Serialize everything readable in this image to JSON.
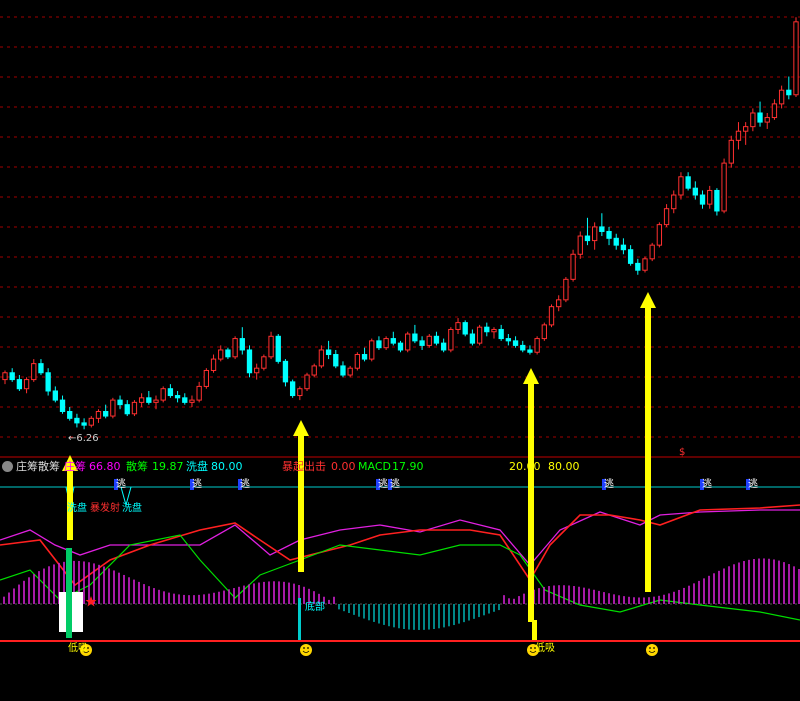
{
  "indicator": {
    "name": "庄筹散筹",
    "values": [
      {
        "label": "庄筹",
        "value": "66.80",
        "color": "#ff00ff"
      },
      {
        "label": "散筹",
        "value": "19.87",
        "color": "#00ff00"
      },
      {
        "label": "洗盘",
        "value": "80.00",
        "color": "#00ffff"
      },
      {
        "label": "暴起出击",
        "value": "0.00",
        "color": "#ff3030"
      },
      {
        "label": "MACD",
        "value": "17.90",
        "color": "#00ff00"
      },
      {
        "label": "",
        "value": "20.00",
        "color": "#ffff00"
      },
      {
        "label": "",
        "value": "80.00",
        "color": "#ffff00"
      }
    ]
  },
  "chart_data": {
    "type": "candlestick",
    "low_marker": "6.26",
    "candles": [
      [
        7.35,
        7.55,
        7.25,
        7.5
      ],
      [
        7.5,
        7.6,
        7.3,
        7.35
      ],
      [
        7.35,
        7.45,
        7.1,
        7.15
      ],
      [
        7.15,
        7.4,
        7.05,
        7.35
      ],
      [
        7.35,
        7.8,
        7.3,
        7.7
      ],
      [
        7.7,
        7.8,
        7.45,
        7.5
      ],
      [
        7.5,
        7.6,
        7.0,
        7.1
      ],
      [
        7.1,
        7.2,
        6.85,
        6.9
      ],
      [
        6.9,
        7.0,
        6.6,
        6.65
      ],
      [
        6.65,
        6.75,
        6.45,
        6.5
      ],
      [
        6.5,
        6.6,
        6.3,
        6.4
      ],
      [
        6.4,
        6.5,
        6.26,
        6.35
      ],
      [
        6.35,
        6.55,
        6.3,
        6.5
      ],
      [
        6.5,
        6.7,
        6.4,
        6.65
      ],
      [
        6.65,
        6.8,
        6.5,
        6.55
      ],
      [
        6.55,
        6.95,
        6.5,
        6.9
      ],
      [
        6.9,
        7.0,
        6.7,
        6.8
      ],
      [
        6.8,
        6.9,
        6.55,
        6.6
      ],
      [
        6.6,
        6.9,
        6.55,
        6.85
      ],
      [
        6.85,
        7.05,
        6.75,
        6.95
      ],
      [
        6.95,
        7.1,
        6.8,
        6.85
      ],
      [
        6.85,
        7.0,
        6.7,
        6.9
      ],
      [
        6.9,
        7.2,
        6.85,
        7.15
      ],
      [
        7.15,
        7.25,
        6.95,
        7.0
      ],
      [
        7.0,
        7.1,
        6.85,
        6.95
      ],
      [
        6.95,
        7.05,
        6.8,
        6.85
      ],
      [
        6.85,
        7.0,
        6.75,
        6.9
      ],
      [
        6.9,
        7.3,
        6.85,
        7.2
      ],
      [
        7.2,
        7.6,
        7.15,
        7.55
      ],
      [
        7.55,
        7.9,
        7.5,
        7.8
      ],
      [
        7.8,
        8.1,
        7.75,
        8.0
      ],
      [
        8.0,
        8.05,
        7.8,
        7.85
      ],
      [
        7.85,
        8.3,
        7.8,
        8.25
      ],
      [
        8.25,
        8.5,
        7.9,
        8.0
      ],
      [
        8.0,
        8.1,
        7.4,
        7.5
      ],
      [
        7.5,
        7.7,
        7.35,
        7.6
      ],
      [
        7.6,
        7.9,
        7.55,
        7.85
      ],
      [
        7.85,
        8.4,
        7.8,
        8.3
      ],
      [
        8.3,
        8.35,
        7.7,
        7.75
      ],
      [
        7.75,
        7.8,
        7.2,
        7.3
      ],
      [
        7.3,
        7.35,
        6.95,
        7.0
      ],
      [
        7.0,
        7.2,
        6.9,
        7.15
      ],
      [
        7.15,
        7.5,
        7.1,
        7.45
      ],
      [
        7.45,
        7.7,
        7.4,
        7.65
      ],
      [
        7.65,
        8.1,
        7.6,
        8.0
      ],
      [
        8.0,
        8.2,
        7.8,
        7.9
      ],
      [
        7.9,
        8.0,
        7.6,
        7.65
      ],
      [
        7.65,
        7.75,
        7.4,
        7.45
      ],
      [
        7.45,
        7.65,
        7.4,
        7.6
      ],
      [
        7.6,
        7.95,
        7.55,
        7.9
      ],
      [
        7.9,
        8.05,
        7.75,
        7.8
      ],
      [
        7.8,
        8.25,
        7.75,
        8.2
      ],
      [
        8.2,
        8.3,
        8.0,
        8.05
      ],
      [
        8.05,
        8.3,
        8.0,
        8.25
      ],
      [
        8.25,
        8.4,
        8.1,
        8.15
      ],
      [
        8.15,
        8.2,
        7.95,
        8.0
      ],
      [
        8.0,
        8.4,
        7.95,
        8.35
      ],
      [
        8.35,
        8.55,
        8.15,
        8.2
      ],
      [
        8.2,
        8.3,
        8.0,
        8.1
      ],
      [
        8.1,
        8.35,
        8.05,
        8.3
      ],
      [
        8.3,
        8.4,
        8.1,
        8.15
      ],
      [
        8.15,
        8.25,
        7.95,
        8.0
      ],
      [
        8.0,
        8.5,
        7.95,
        8.45
      ],
      [
        8.45,
        8.7,
        8.35,
        8.6
      ],
      [
        8.6,
        8.65,
        8.3,
        8.35
      ],
      [
        8.35,
        8.45,
        8.1,
        8.15
      ],
      [
        8.15,
        8.55,
        8.1,
        8.5
      ],
      [
        8.5,
        8.6,
        8.3,
        8.4
      ],
      [
        8.4,
        8.5,
        8.25,
        8.45
      ],
      [
        8.45,
        8.55,
        8.2,
        8.25
      ],
      [
        8.25,
        8.35,
        8.1,
        8.2
      ],
      [
        8.2,
        8.3,
        8.05,
        8.1
      ],
      [
        8.1,
        8.2,
        7.95,
        8.0
      ],
      [
        8.0,
        8.1,
        7.9,
        7.95
      ],
      [
        7.95,
        8.3,
        7.9,
        8.25
      ],
      [
        8.25,
        8.6,
        8.2,
        8.55
      ],
      [
        8.55,
        9.0,
        8.5,
        8.95
      ],
      [
        8.95,
        9.2,
        8.85,
        9.1
      ],
      [
        9.1,
        9.6,
        9.05,
        9.55
      ],
      [
        9.55,
        10.2,
        9.5,
        10.1
      ],
      [
        10.1,
        10.6,
        10.0,
        10.5
      ],
      [
        10.5,
        10.9,
        10.3,
        10.4
      ],
      [
        10.4,
        10.8,
        10.2,
        10.7
      ],
      [
        10.7,
        11.0,
        10.5,
        10.6
      ],
      [
        10.6,
        10.7,
        10.3,
        10.45
      ],
      [
        10.45,
        10.55,
        10.2,
        10.3
      ],
      [
        10.3,
        10.45,
        10.1,
        10.2
      ],
      [
        10.2,
        10.3,
        9.85,
        9.9
      ],
      [
        9.9,
        10.0,
        9.65,
        9.75
      ],
      [
        9.75,
        10.05,
        9.7,
        10.0
      ],
      [
        10.0,
        10.35,
        9.95,
        10.3
      ],
      [
        10.3,
        10.8,
        10.25,
        10.75
      ],
      [
        10.75,
        11.2,
        10.7,
        11.1
      ],
      [
        11.1,
        11.5,
        11.0,
        11.4
      ],
      [
        11.4,
        11.9,
        11.3,
        11.8
      ],
      [
        11.8,
        11.9,
        11.5,
        11.55
      ],
      [
        11.55,
        11.7,
        11.3,
        11.4
      ],
      [
        11.4,
        11.5,
        11.1,
        11.2
      ],
      [
        11.2,
        11.6,
        11.1,
        11.5
      ],
      [
        11.5,
        11.55,
        10.95,
        11.05
      ],
      [
        11.05,
        12.2,
        11.0,
        12.1
      ],
      [
        12.1,
        12.7,
        12.0,
        12.6
      ],
      [
        12.6,
        13.0,
        12.4,
        12.8
      ],
      [
        12.8,
        13.0,
        12.5,
        12.9
      ],
      [
        12.9,
        13.3,
        12.8,
        13.2
      ],
      [
        13.2,
        13.45,
        12.9,
        13.0
      ],
      [
        13.0,
        13.2,
        12.85,
        13.1
      ],
      [
        13.1,
        13.5,
        13.05,
        13.4
      ],
      [
        13.4,
        13.8,
        13.3,
        13.7
      ],
      [
        13.7,
        14.0,
        13.5,
        13.6
      ],
      [
        13.6,
        15.3,
        13.55,
        15.2
      ]
    ],
    "annotations": [
      "洗盘",
      "暴发射",
      "洗盘",
      "逃",
      "逃",
      "逃",
      "逃",
      "逃",
      "逃",
      "逃",
      "逃",
      "底部",
      "低吸",
      "低吸",
      "$"
    ],
    "colors": {
      "up": "#ff3030",
      "down": "#00ffff",
      "grid": "#a00000",
      "arrow": "#ffff00"
    }
  }
}
